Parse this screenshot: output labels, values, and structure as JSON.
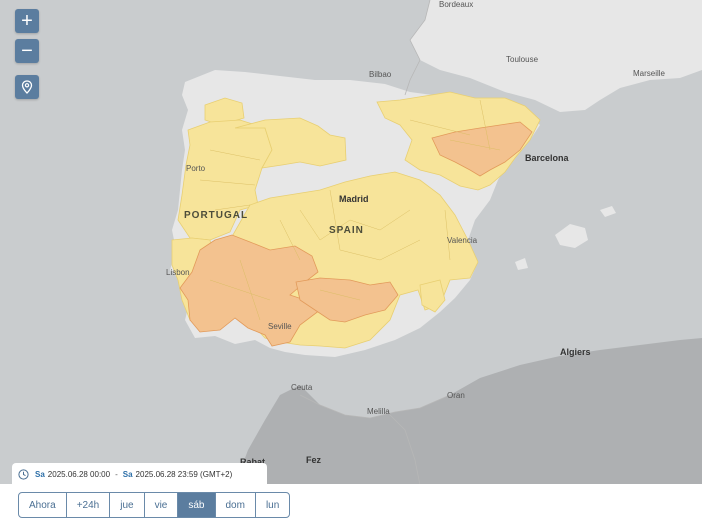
{
  "controls": {
    "zoom_in": "+",
    "zoom_out": "−"
  },
  "labels": {
    "bordeaux": "Bordeaux",
    "toulouse": "Toulouse",
    "marseille": "Marseille",
    "bilbao": "Bilbao",
    "barcelona": "Barcelona",
    "porto": "Porto",
    "portugal": "PORTUGAL",
    "madrid": "Madrid",
    "spain": "SPAIN",
    "valencia": "Valencia",
    "lisbon": "Lisbon",
    "seville": "Seville",
    "algiers": "Algiers",
    "ceuta": "Ceuta",
    "oran": "Oran",
    "melilla": "Melilla",
    "rabat": "Rabat",
    "fez": "Fez"
  },
  "time_range": {
    "from_day": "Sa",
    "from_value": "2025.06.28 00:00",
    "separator": "-",
    "to_day": "Sa",
    "to_value": "2025.06.28 23:59 (GMT+2)"
  },
  "tabs": [
    {
      "label": "Ahora",
      "active": false
    },
    {
      "label": "+24h",
      "active": false
    },
    {
      "label": "jue",
      "active": false
    },
    {
      "label": "vie",
      "active": false
    },
    {
      "label": "sáb",
      "active": true
    },
    {
      "label": "dom",
      "active": false
    },
    {
      "label": "lun",
      "active": false
    }
  ],
  "colors": {
    "sea": "#c9ccce",
    "land_europe": "#e7e7e7",
    "land_africa": "#aeb0b2",
    "warning_yellow": "#f7e49a",
    "warning_orange": "#f3c28f",
    "accent": "#5b7d9f"
  }
}
